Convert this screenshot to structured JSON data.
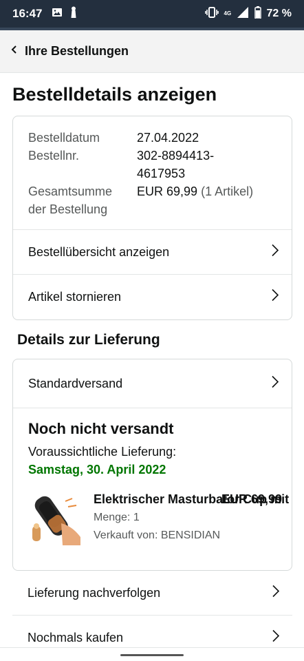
{
  "status_bar": {
    "time": "16:47",
    "network": "4G",
    "battery": "72 %",
    "icons": [
      "image-icon",
      "notification-icon",
      "vibrate-icon",
      "signal-icon",
      "battery-icon"
    ]
  },
  "header": {
    "back_label": "Ihre Bestellungen"
  },
  "page_title": "Bestelldetails anzeigen",
  "order_info": {
    "date_label": "Bestelldatum",
    "date_value": "27.04.2022",
    "number_label": "Bestellnr.",
    "number_value_line1": "302-8894413-",
    "number_value_line2": "4617953",
    "total_label_line1": "Gesamtsumme",
    "total_label_line2": "der Bestellung",
    "total_value": "EUR 69,99",
    "total_items": "(1 Artikel)"
  },
  "order_links": {
    "overview": "Bestellübersicht anzeigen",
    "cancel": "Artikel stornieren"
  },
  "delivery_section_title": "Details zur Lieferung",
  "delivery": {
    "shipping_method": "Standardversand",
    "status": "Noch nicht versandt",
    "eta_label": "Voraussichtliche Lieferung:",
    "eta_date": "Samstag, 30. April 2022",
    "eta_color": "#007600"
  },
  "product": {
    "name": "Elektrischer Masturbator Cup mit V",
    "price": "EUR 69,99",
    "quantity": "Menge: 1",
    "seller": "Verkauft von: BENSIDIAN"
  },
  "bottom_links": {
    "track": "Lieferung nachverfolgen",
    "buy_again": "Nochmals kaufen"
  },
  "colors": {
    "status_bar_bg": "#232f3e",
    "header_bg": "#f3f3f3",
    "border": "#d5d9d9"
  }
}
